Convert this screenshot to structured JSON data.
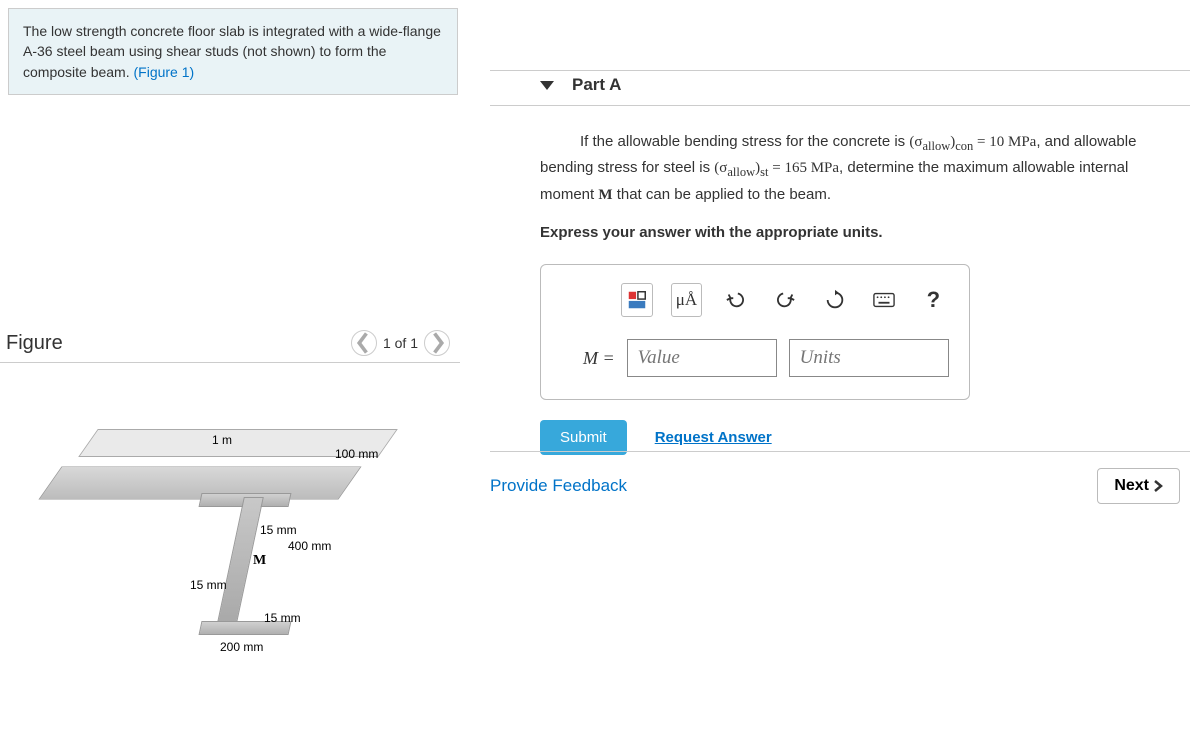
{
  "intro": {
    "text": "The low strength concrete floor slab is integrated with a wide-flange A-36 steel beam using shear studs (not shown) to form the composite beam. ",
    "link": "(Figure 1)"
  },
  "figure": {
    "title": "Figure",
    "pager": "1 of 1",
    "labels": {
      "width": "1 m",
      "slab_thk": "100 mm",
      "tf_top": "15 mm",
      "web_h": "400 mm",
      "M": "M",
      "tw": "15 mm",
      "tf_bot": "15 mm",
      "bf": "200 mm"
    }
  },
  "part": {
    "label": "Part A",
    "q1": "If the allowable bending stress for the concrete is ",
    "sig_con": "(σ",
    "allow": "allow",
    "paren": ")",
    "con_sub": "con",
    "eq1": " = 10 MPa",
    "q2": ", and allowable bending stress for steel is ",
    "st_sub": "st",
    "eq2": " = 165 MPa",
    "q3": ", determine the maximum allowable internal moment ",
    "M": "M",
    "q4": " that can be applied to the beam.",
    "instruct": "Express your answer with the appropriate units."
  },
  "toolbar": {
    "units_sym": "μÅ",
    "help": "?"
  },
  "answer": {
    "var": "M =",
    "value_ph": "Value",
    "units_ph": "Units"
  },
  "actions": {
    "submit": "Submit",
    "request": "Request Answer"
  },
  "footer": {
    "feedback": "Provide Feedback",
    "next": "Next"
  }
}
